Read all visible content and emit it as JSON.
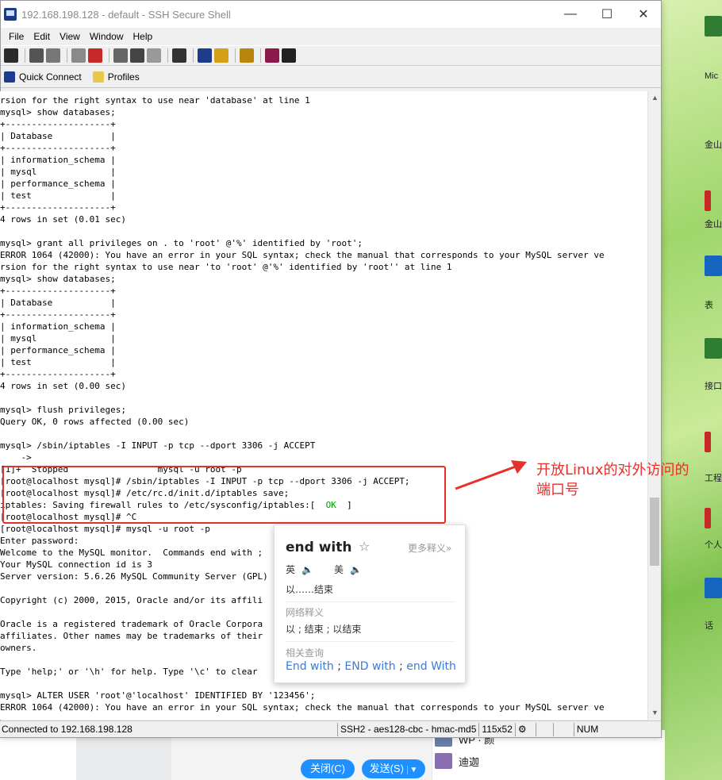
{
  "window": {
    "title": "192.168.198.128 - default - SSH Secure Shell",
    "controls": {
      "minimize": "—",
      "maximize": "☐",
      "close": "✕"
    }
  },
  "menu": [
    "File",
    "Edit",
    "View",
    "Window",
    "Help"
  ],
  "toolbar_icons": [
    "save-icon",
    "print-icon",
    "print-preview-icon",
    "disconnect-icon",
    "reconnect-icon",
    "copy-icon",
    "paste-icon",
    "paste-special-icon",
    "find-icon",
    "new-terminal-icon",
    "new-file-transfer-icon",
    "settings-icon",
    "help-book-icon",
    "context-help-icon"
  ],
  "linkbar": {
    "quick_connect": "Quick Connect",
    "profiles": "Profiles"
  },
  "terminal": {
    "lines": [
      "rsion for the right syntax to use near 'database' at line 1",
      "mysql> show databases;",
      "+--------------------+",
      "| Database           |",
      "+--------------------+",
      "| information_schema |",
      "| mysql              |",
      "| performance_schema |",
      "| test               |",
      "+--------------------+",
      "4 rows in set (0.01 sec)",
      "",
      "mysql> grant all privileges on . to 'root' @'%' identified by 'root';",
      "ERROR 1064 (42000): You have an error in your SQL syntax; check the manual that corresponds to your MySQL server ve",
      "rsion for the right syntax to use near 'to 'root' @'%' identified by 'root'' at line 1",
      "mysql> show databases;",
      "+--------------------+",
      "| Database           |",
      "+--------------------+",
      "| information_schema |",
      "| mysql              |",
      "| performance_schema |",
      "| test               |",
      "+--------------------+",
      "4 rows in set (0.00 sec)",
      "",
      "mysql> flush privileges;",
      "Query OK, 0 rows affected (0.00 sec)",
      "",
      "mysql> /sbin/iptables -I INPUT -p tcp --dport 3306 -j ACCEPT",
      "    ->",
      "[1]+  Stopped                 mysql -u root -p",
      "[root@localhost mysql]# /sbin/iptables -I INPUT -p tcp --dport 3306 -j ACCEPT;",
      "[root@localhost mysql]# /etc/rc.d/init.d/iptables save;",
      "iptables: Saving firewall rules to /etc/sysconfig/iptables:[  ",
      "[root@localhost mysql]# ^C",
      "[root@localhost mysql]# mysql -u root -p",
      "Enter password:",
      "Welcome to the MySQL monitor.  Commands end with ;",
      "Your MySQL connection id is 3",
      "Server version: 5.6.26 MySQL Community Server (GPL)",
      "",
      "Copyright (c) 2000, 2015, Oracle and/or its affili",
      "",
      "Oracle is a registered trademark of Oracle Corpora",
      "affiliates. Other names may be trademarks of their",
      "owners.",
      "",
      "Type 'help;' or '\\h' for help. Type '\\c' to clear",
      "",
      "mysql> ALTER USER 'root'@'localhost' IDENTIFIED BY '123456';",
      "ERROR 1064 (42000): You have an error in your SQL syntax; check the manual that corresponds to your MySQL server ve"
    ],
    "ok_text": "OK",
    "ok_suffix": "  ]"
  },
  "statusbar": {
    "connection": "Connected to 192.168.198.128",
    "cipher": "SSH2 - aes128-cbc - hmac-md5",
    "size": "115x52",
    "num": "NUM"
  },
  "annotation": {
    "line1": "开放Linux的对外访问的",
    "line2": "端口号"
  },
  "dictionary": {
    "word": "end with",
    "more": "更多释义»",
    "pron_en": "英",
    "pron_us": "美",
    "meaning": "以……结束",
    "web_heading": "网络释义",
    "web_meaning": "以 ; 结束 ; 以结束",
    "related_heading": "相关查询",
    "related": [
      "End with",
      "END with",
      "end With"
    ]
  },
  "chat": {
    "close_button": "关闭(C)",
    "send_button": "发送(S)",
    "contacts": [
      "WP · 颜",
      "迪迦"
    ]
  },
  "desktop_labels": [
    "Mic",
    "金山",
    "金山",
    "表",
    "接口",
    "工程",
    "个人",
    "话"
  ]
}
